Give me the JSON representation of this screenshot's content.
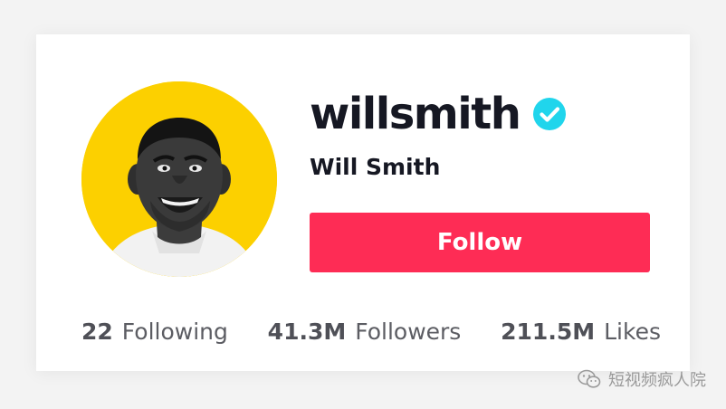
{
  "profile": {
    "username": "willsmith",
    "display_name": "Will Smith",
    "verified_icon": "verified-check-icon",
    "follow_label": "Follow"
  },
  "stats": [
    {
      "value": "22",
      "label": "Following"
    },
    {
      "value": "41.3M",
      "label": "Followers"
    },
    {
      "value": "211.5M",
      "label": "Likes"
    }
  ],
  "watermark": {
    "text": "短视频疯人院",
    "icon": "wechat-icon"
  },
  "colors": {
    "follow_button": "#fe2c55",
    "avatar_background": "#fcd000",
    "verified_badge": "#20d5ec"
  }
}
